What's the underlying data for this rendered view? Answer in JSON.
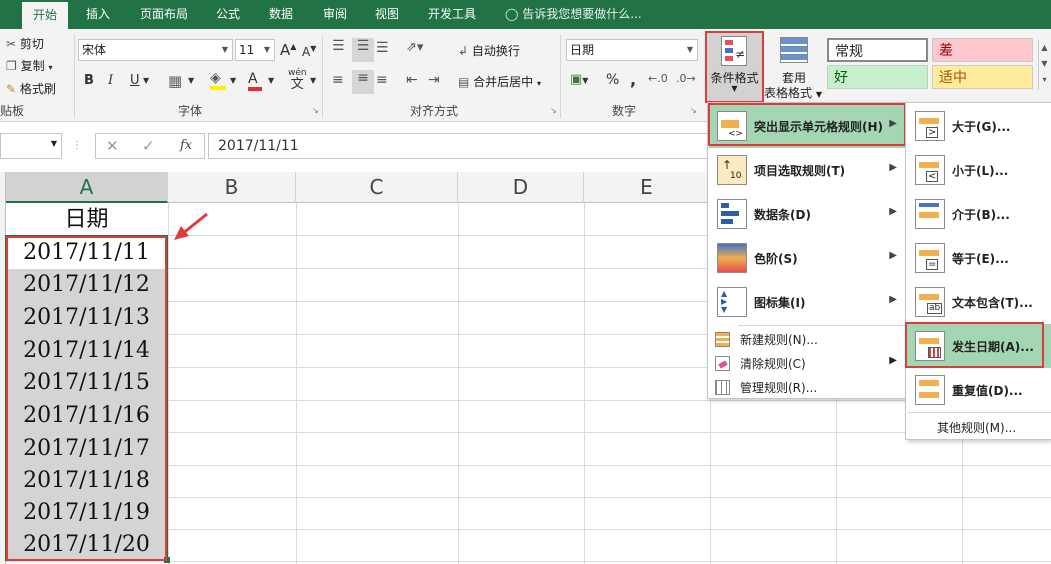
{
  "tabs": [
    "开始",
    "插入",
    "页面布局",
    "公式",
    "数据",
    "审阅",
    "视图",
    "开发工具"
  ],
  "tell_me": "告诉我您想要做什么...",
  "clipboard": {
    "cut": "剪切",
    "copy": "复制",
    "format_painter": "格式刷",
    "group_label": "贴板"
  },
  "font": {
    "name": "宋体",
    "size": "11",
    "bold": "B",
    "italic": "I",
    "underline": "U",
    "font_color_glyph": "A",
    "wen": "wén",
    "wen_char": "文",
    "group_label": "字体",
    "grow": "A",
    "shrink": "A"
  },
  "alignment": {
    "wrap_text": "自动换行",
    "merge_center": "合并后居中",
    "group_label": "对齐方式"
  },
  "number": {
    "format": "日期",
    "percent": "%",
    "comma": ",",
    "group_label": "数字"
  },
  "styles": {
    "conditional_formatting": "条件格式",
    "format_as_table_1": "套用",
    "format_as_table_2": "表格格式",
    "normal": "常规",
    "bad": "差",
    "good": "好",
    "neutral": "适中"
  },
  "formula_bar": {
    "fx": "fx",
    "value": "2017/11/11"
  },
  "columns": [
    "A",
    "B",
    "C",
    "D",
    "E"
  ],
  "column_a": {
    "header": "日期",
    "dates": [
      "2017/11/11",
      "2017/11/12",
      "2017/11/13",
      "2017/11/14",
      "2017/11/15",
      "2017/11/16",
      "2017/11/17",
      "2017/11/18",
      "2017/11/19",
      "2017/11/20"
    ]
  },
  "cf_menu": {
    "items": [
      "突出显示单元格规则(H)",
      "项目选取规则(T)",
      "数据条(D)",
      "色阶(S)",
      "图标集(I)"
    ],
    "small_items": [
      "新建规则(N)...",
      "清除规则(C)",
      "管理规则(R)..."
    ]
  },
  "highlight_submenu": {
    "items": [
      "大于(G)...",
      "小于(L)...",
      "介于(B)...",
      "等于(E)...",
      "文本包含(T)...",
      "发生日期(A)...",
      "重复值(D)..."
    ],
    "more": "其他规则(M)..."
  },
  "colors": {
    "excel_green": "#217346",
    "highlight_green": "#a5d6b4",
    "annotation_red": "#e03b3b",
    "bad_bg": "#ffc7ce",
    "good_bg": "#c6efce",
    "neutral_bg": "#ffeb9c"
  }
}
